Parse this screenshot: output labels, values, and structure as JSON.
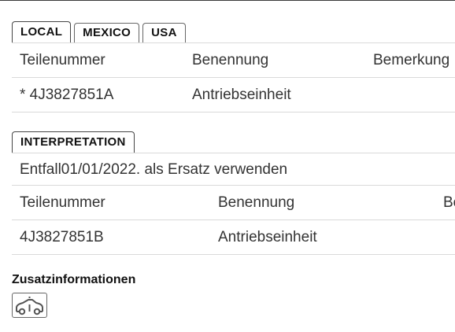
{
  "tabs": {
    "local": "LOCAL",
    "mexico": "MEXICO",
    "usa": "USA"
  },
  "parts_table": {
    "headers": [
      "Teilenummer",
      "Benennung",
      "Bemerkung"
    ],
    "rows": [
      [
        "* 4J3827851A",
        "Antriebseinheit",
        ""
      ]
    ]
  },
  "interpretation": {
    "tab_label": "INTERPRETATION",
    "note": "Entfall01/01/2022. als Ersatz verwenden",
    "headers": [
      "Teilenummer",
      "Benennung",
      "Be"
    ],
    "rows": [
      [
        "4J3827851B",
        "Antriebseinheit",
        ""
      ]
    ]
  },
  "additional": {
    "title": "Zusatzinformationen",
    "icon": "vehicle-icon"
  },
  "colors": {
    "border": "#555555",
    "divider": "#dadada",
    "text": "#333333"
  }
}
